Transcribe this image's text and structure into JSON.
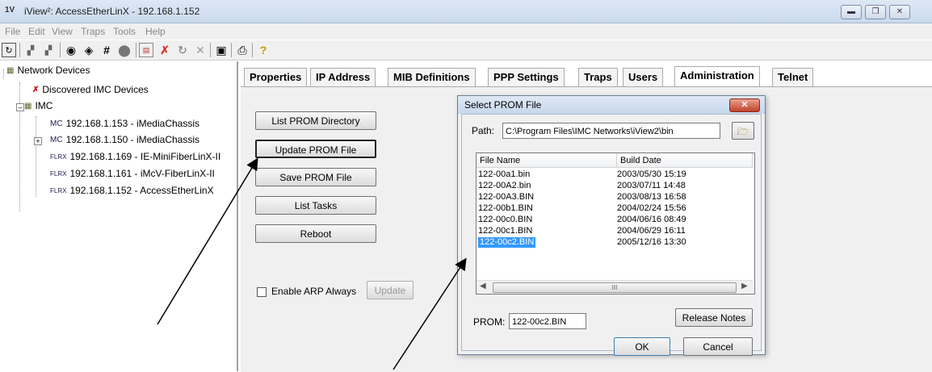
{
  "window": {
    "app_icon": "1V",
    "title": "iView²: AccessEtherLinX - 192.168.1.152",
    "buttons": [
      "minimize-icon",
      "restore-icon",
      "close-icon"
    ]
  },
  "menu": [
    "File",
    "Edit",
    "View",
    "Traps",
    "Tools",
    "Help"
  ],
  "toolbar_icons": [
    "refresh-icon",
    "tree-collapse-icon",
    "tree-expand-icon",
    "network-icon",
    "eye-icon",
    "grid-icon",
    "stop-icon",
    "log-icon",
    "delete-icon",
    "cancel-icon",
    "close-x-icon",
    "screen-icon",
    "print-icon",
    "help-icon"
  ],
  "tree": {
    "root": "Network Devices",
    "discovered": "Discovered IMC Devices",
    "group": "IMC",
    "devices": [
      {
        "label": "192.168.1.153 - iMediaChassis",
        "badge": "MC"
      },
      {
        "label": "192.168.1.150 - iMediaChassis",
        "badge": "MC"
      },
      {
        "label": "192.168.1.169 - IE-MiniFiberLinX-II",
        "badge": "FLRX"
      },
      {
        "label": "192.168.1.161 - iMcV-FiberLinX-II",
        "badge": "FLRX"
      },
      {
        "label": "192.168.1.152 - AccessEtherLinX",
        "badge": "FLRX"
      }
    ]
  },
  "tabs": [
    "Properties",
    "IP Address",
    "MIB Definitions",
    "PPP Settings",
    "Traps",
    "Users",
    "Administration",
    "Telnet"
  ],
  "active_tab": "Administration",
  "admin": {
    "list_prom_directory": "List PROM Directory",
    "update_prom_file": "Update PROM File",
    "save_prom_file": "Save PROM File",
    "list_tasks": "List Tasks",
    "reboot": "Reboot",
    "enable_arp_label": "Enable ARP Always",
    "enable_arp_checked": false,
    "update": "Update"
  },
  "dialog": {
    "title": "Select PROM File",
    "path_label": "Path:",
    "path_value": "C:\\Program Files\\IMC Networks\\iView2\\bin",
    "columns": [
      "File Name",
      "Build Date"
    ],
    "files": [
      {
        "name": "122-00a1.bin",
        "date": "2003/05/30 15:19"
      },
      {
        "name": "122-00A2.bin",
        "date": "2003/07/11 14:48"
      },
      {
        "name": "122-00A3.BIN",
        "date": "2003/08/13 16:58"
      },
      {
        "name": "122-00b1.BIN",
        "date": "2004/02/24 15:56"
      },
      {
        "name": "122-00c0.BIN",
        "date": "2004/06/16 08:49"
      },
      {
        "name": "122-00c1.BIN",
        "date": "2004/06/29 16:11"
      },
      {
        "name": "122-00c2.BIN",
        "date": "2005/12/16 13:30"
      }
    ],
    "selected_file": "122-00c2.BIN",
    "prom_label": "PROM:",
    "prom_value": "122-00c2.BIN",
    "release_notes": "Release Notes",
    "ok": "OK",
    "cancel": "Cancel",
    "scroll_mid": "III"
  }
}
